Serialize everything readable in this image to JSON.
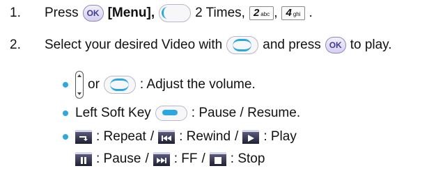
{
  "steps": [
    {
      "number": "1.",
      "press": "Press",
      "menu": "[Menu],",
      "times": "2 Times,",
      "comma": ",",
      "period": ".",
      "key2": {
        "digit": "2",
        "letters": "abc"
      },
      "key4": {
        "digit": "4",
        "letters": "ghi"
      },
      "ok_label": "OK"
    },
    {
      "number": "2.",
      "text_before": "Select your desired Video with",
      "text_middle": "and press",
      "text_after": "to play.",
      "ok_label": "OK"
    }
  ],
  "bullets": {
    "volume": {
      "or": "or",
      "text": ": Adjust the volume."
    },
    "softkey": {
      "before": "Left Soft Key",
      "after": ": Pause / Resume."
    },
    "controls1": {
      "repeat": ": Repeat",
      "sep": "/",
      "rewind": ": Rewind",
      "play": ": Play"
    },
    "controls2": {
      "pause": ": Pause",
      "sep": "/",
      "ff": ": FF",
      "stop": ": Stop"
    }
  },
  "colors": {
    "bullet": "#2ea9df",
    "nav_highlight": "#29a7de",
    "ok_text": "#3d3d8f"
  },
  "icons": [
    "ok-key-icon",
    "nav-left-key-icon",
    "nav-updown-key-icon",
    "side-volume-key-icon",
    "left-soft-key-icon",
    "repeat-icon",
    "rewind-icon",
    "play-icon",
    "pause-icon",
    "fast-forward-icon",
    "stop-icon"
  ]
}
